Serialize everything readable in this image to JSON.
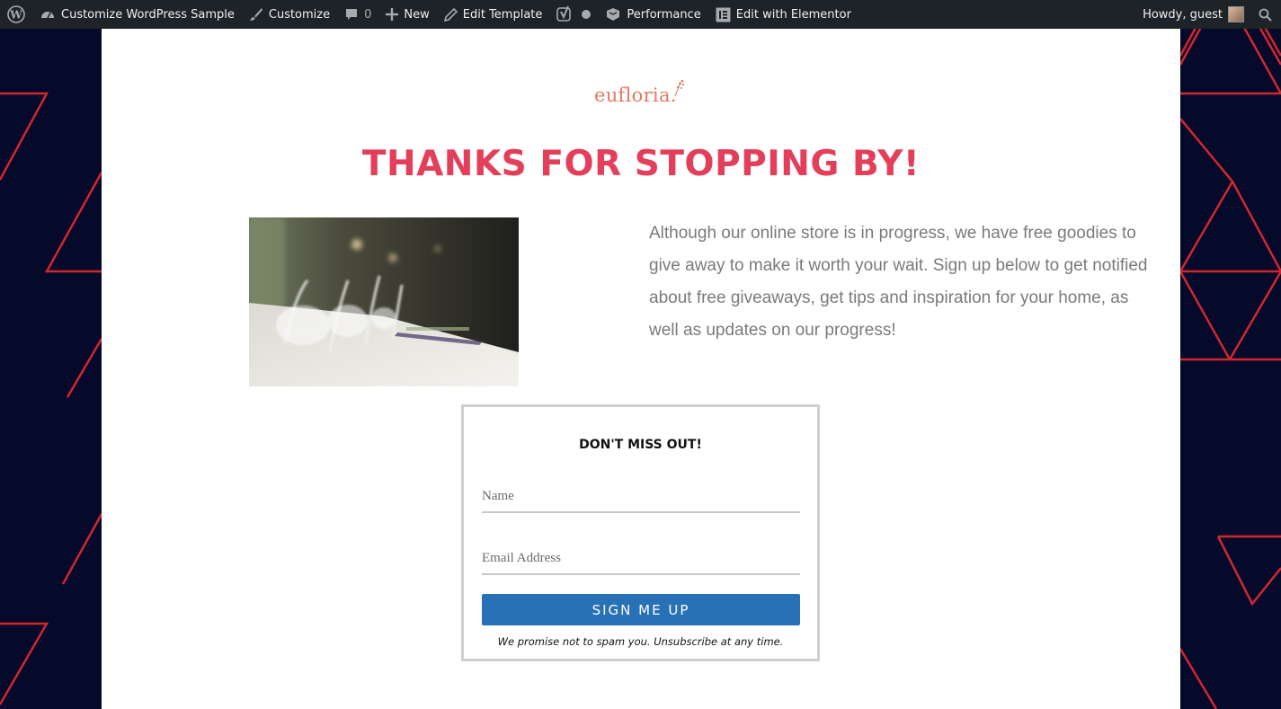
{
  "admin_bar": {
    "site_name": "Customize WordPress Sample",
    "customize": "Customize",
    "comments_count": "0",
    "new": "New",
    "edit_template": "Edit Template",
    "performance": "Performance",
    "edit_elementor": "Edit with Elementor",
    "howdy": "Howdy, guest",
    "icons": [
      "wordpress-logo-icon",
      "dashboard-icon",
      "brush-icon",
      "comment-icon",
      "plus-icon",
      "pencil-icon",
      "yoast-icon",
      "status-dot-icon",
      "performance-icon",
      "elementor-icon",
      "avatar",
      "search-icon"
    ]
  },
  "page": {
    "logo_text": "eufloria.",
    "headline": "THANKS FOR STOPPING BY!",
    "intro": "Although our online store is in progress, we have free goodies to give away to make it worth your wait. Sign up below to get notified about free giveaways, get tips and inspiration for your home, as well as updates on our progress!",
    "image_alt": "Long banquet table with wine glasses"
  },
  "signup": {
    "title": "DON'T MISS OUT!",
    "name_placeholder": "Name",
    "email_placeholder": "Email Address",
    "button_label": "SIGN ME UP",
    "disclaimer": "We promise not to spam you. Unsubscribe at any time."
  },
  "colors": {
    "admin_bar_bg": "#1d2327",
    "page_bg": "#050a2a",
    "pattern_red": "#d2262f",
    "headline": "#e43f5a",
    "logo": "#e07a5f",
    "button": "#2971b7"
  }
}
